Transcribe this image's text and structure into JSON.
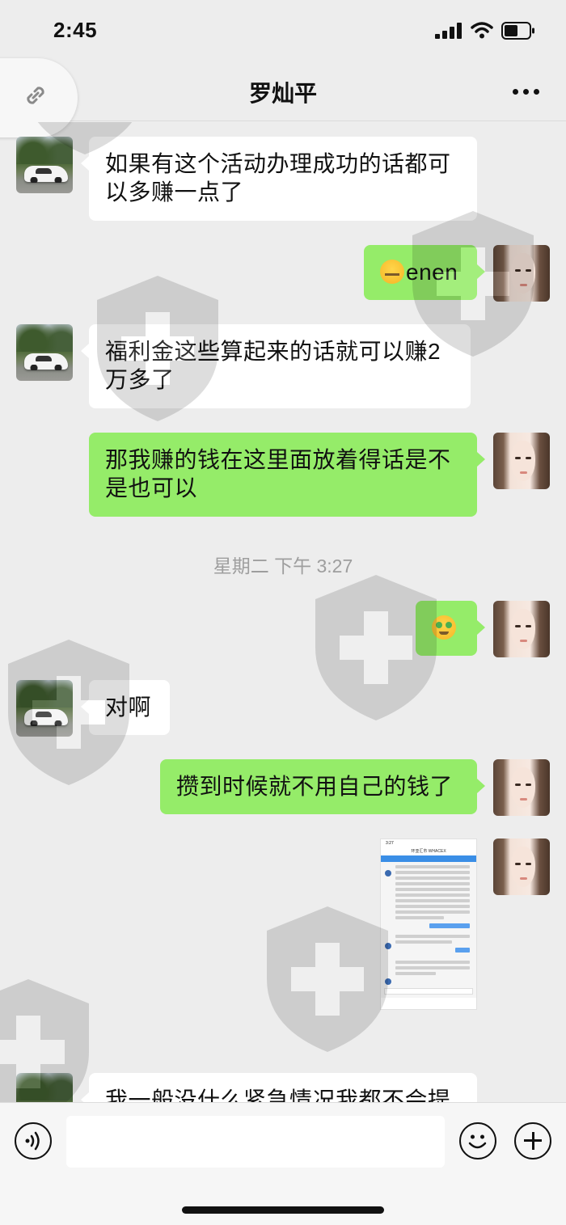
{
  "status_bar": {
    "time": "2:45"
  },
  "header": {
    "title": "罗灿平"
  },
  "messages": [
    {
      "side": "in",
      "text": "如果有这个活动办理成功的话都可以多赚一点了"
    },
    {
      "side": "out",
      "emoji": "zipper-mouth-emoji",
      "text": "enen"
    },
    {
      "side": "in",
      "text": "福利金这些算起来的话就可以赚2万多了"
    },
    {
      "side": "out",
      "text": "那我赚的钱在这里面放着得话是不是也可以"
    },
    {
      "side": "out",
      "emoji": "money-face-emoji",
      "text": ""
    },
    {
      "side": "in",
      "text": "对啊"
    },
    {
      "side": "out",
      "text": "攒到时候就不用自己的钱了"
    },
    {
      "side": "out",
      "type": "image",
      "image_title": "环亚汇市 WHACEX"
    },
    {
      "side": "in",
      "text": "我一般没什么紧急情况我都不会提"
    }
  ],
  "timestamp": "星期二 下午 3:27",
  "input": {
    "value": ""
  }
}
